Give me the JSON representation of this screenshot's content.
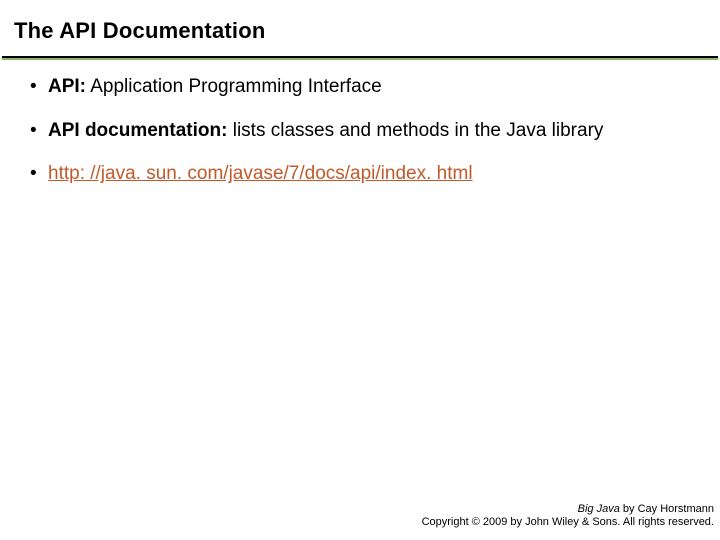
{
  "title": "The API Documentation",
  "bullets": {
    "b1_label": "API:",
    "b1_text": " Application Programming Interface",
    "b2_label": "API documentation:",
    "b2_text": " lists classes and methods in the Java library",
    "b3_link": "http: //java. sun. com/javase/7/docs/api/index. html"
  },
  "footer": {
    "book": "Big Java",
    "byline": " by Cay Horstmann",
    "copyright": "Copyright © 2009 by John Wiley & Sons. All rights reserved."
  }
}
